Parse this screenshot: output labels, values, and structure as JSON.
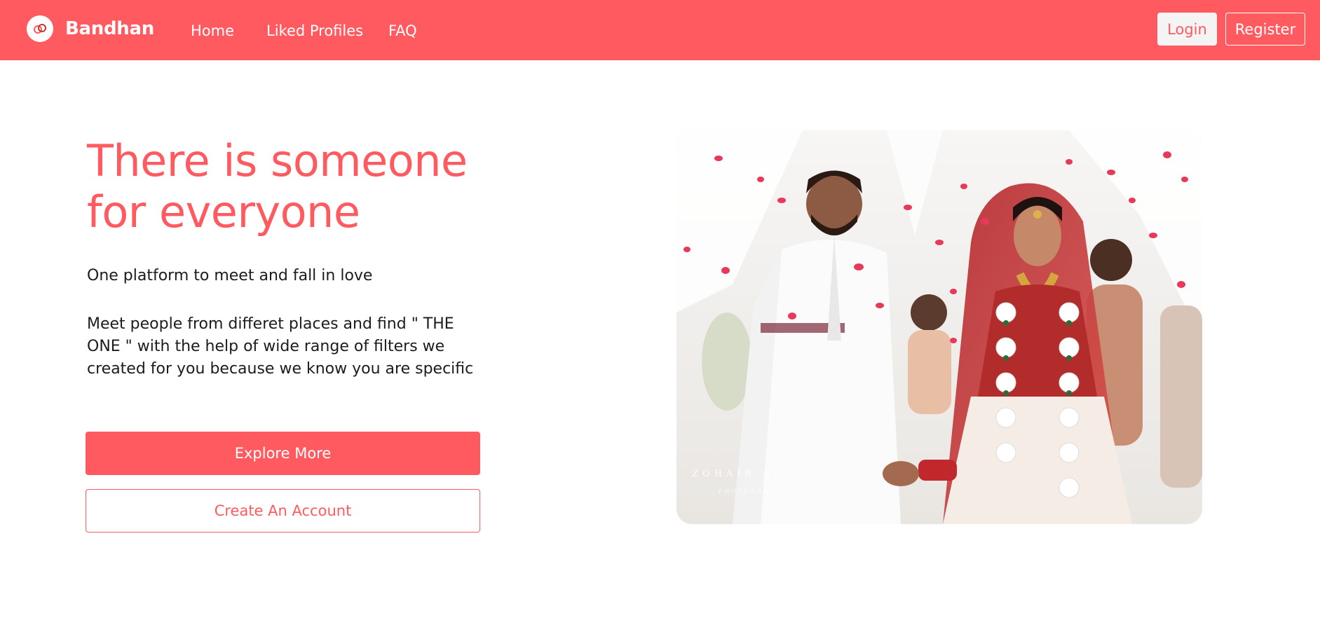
{
  "navbar": {
    "brand": "Bandhan",
    "brand_icon": "rings-icon",
    "links": [
      "Home",
      "Liked Profiles",
      "FAQ"
    ],
    "login_label": "Login",
    "register_label": "Register",
    "background_color": "#ff5a60"
  },
  "hero": {
    "title": "There is someone for everyone",
    "tagline": "One platform to meet and fall in love",
    "description": "Meet people from differet places and find \" THE ONE \" with the help of wide range of filters we created for you because we know you are specific",
    "explore_label": "Explore More",
    "create_label": "Create An Account",
    "accent_color": "#ff5a60"
  },
  "image": {
    "watermark": "ZOHAIB ALI",
    "watermark_sub": "PHOTOGRAPHY"
  }
}
